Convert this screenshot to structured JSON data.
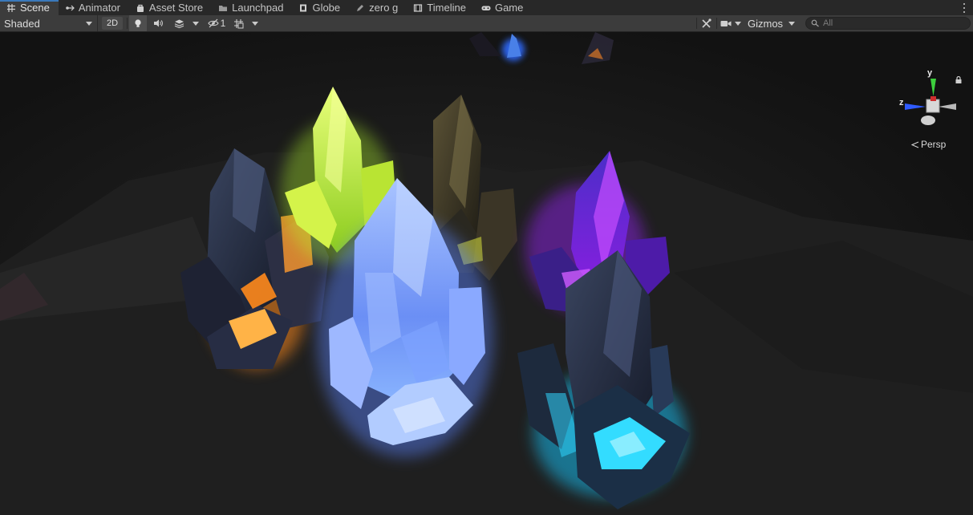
{
  "tabs": [
    {
      "label": "Scene",
      "icon": "grid-icon",
      "active": true
    },
    {
      "label": "Animator",
      "icon": "animator-icon",
      "active": false
    },
    {
      "label": "Asset Store",
      "icon": "bag-icon",
      "active": false
    },
    {
      "label": "Launchpad",
      "icon": "folder-icon",
      "active": false
    },
    {
      "label": "Globe",
      "icon": "globe-icon",
      "active": false
    },
    {
      "label": "zero g",
      "icon": "pencil-icon",
      "active": false
    },
    {
      "label": "Timeline",
      "icon": "timeline-icon",
      "active": false
    },
    {
      "label": "Game",
      "icon": "gamepad-icon",
      "active": false
    }
  ],
  "toolbar": {
    "draw_mode": "Shaded",
    "mode_2d": "2D",
    "hidden_count": "1",
    "gizmos_label": "Gizmos",
    "search_placeholder": "All"
  },
  "orientation_gizmo": {
    "y_label": "y",
    "z_label": "z",
    "projection_label": "Persp"
  },
  "colors": {
    "accent": "#3a79bb",
    "crystal_orange": "#ff9a2e",
    "crystal_lime": "#c8f03a",
    "crystal_blue": "#7fa8ff",
    "crystal_purple": "#b43cff",
    "crystal_cyan": "#2fd6ff",
    "axis_y": "#3dcf3d",
    "axis_z": "#2f5bff"
  }
}
